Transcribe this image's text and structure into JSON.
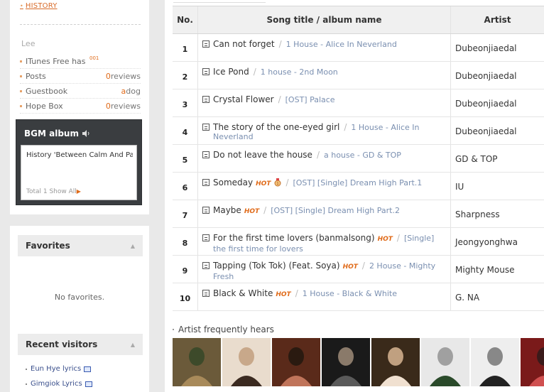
{
  "sidebar": {
    "history_link": "HISTORY",
    "owner_name": "Lee",
    "menu": [
      {
        "label": "ITunes Free has",
        "count": "",
        "count_extra": ""
      },
      {
        "label": "Posts",
        "count": "0",
        "count_extra": "reviews"
      },
      {
        "label": "Guestbook",
        "count": "a",
        "count_extra": "dog"
      },
      {
        "label": "Hope Box",
        "count": "0",
        "count_extra": "reviews"
      }
    ],
    "itunes_dots": "001",
    "bgm": {
      "title": "BGM album",
      "track": "History 'Between Calm And Pa",
      "total": "Total 1 Show All"
    },
    "favorites": {
      "title": "Favorites",
      "empty": "No favorites."
    },
    "recent_visitors": {
      "title": "Recent visitors",
      "items": [
        "Eun Hye lyrics",
        "Gimgiok Lyrics"
      ]
    }
  },
  "table": {
    "headers": {
      "no": "No.",
      "title": "Song title / album name",
      "artist": "Artist"
    },
    "rows": [
      {
        "no": "1",
        "title": "Can not forget",
        "hot": "",
        "album": "1 House - Alice In Neverland",
        "artist": "Dubeonjiaedal"
      },
      {
        "no": "2",
        "title": "Ice Pond",
        "hot": "",
        "album": "1 house - 2nd Moon",
        "artist": "Dubeonjiaedal"
      },
      {
        "no": "3",
        "title": "Crystal Flower",
        "hot": "",
        "album": "[OST] Palace",
        "artist": "Dubeonjiaedal"
      },
      {
        "no": "4",
        "title": "The story of the one-eyed girl",
        "hot": "",
        "album": "1 House - Alice In Neverland",
        "artist": "Dubeonjiaedal"
      },
      {
        "no": "5",
        "title": "Do not leave the house",
        "hot": "",
        "album": "a house - GD & TOP",
        "artist": "GD & TOP"
      },
      {
        "no": "6",
        "title": "Someday",
        "hot": "HOT",
        "album": "[OST] [Single] Dream High Part.1",
        "artist": "IU"
      },
      {
        "no": "7",
        "title": "Maybe",
        "hot": "HOT",
        "album": "[OST] [Single] Dream High Part.2",
        "artist": "Sharpness"
      },
      {
        "no": "8",
        "title": "For the first time lovers (banmalsong)",
        "hot": "HOT",
        "album": "[Single] the first time for lovers",
        "artist": "Jeongyonghwa"
      },
      {
        "no": "9",
        "title": "Tapping (Tok Tok) (Feat. Soya)",
        "hot": "HOT",
        "album": "2 House - Mighty Fresh",
        "artist": "Mighty Mouse"
      },
      {
        "no": "10",
        "title": "Black & White",
        "hot": "HOT",
        "album": "1 House - Black & White",
        "artist": "G. NA"
      }
    ]
  },
  "frequent_artists": {
    "label": "Artist frequently hears",
    "photos": [
      "group-photo",
      "female-portrait",
      "male-portrait",
      "band-photo",
      "female-portrait-hat",
      "duo-photo",
      "female-portrait-bw",
      "portrait-red"
    ]
  },
  "colors": {
    "accent_orange": "#e06b1a",
    "album_blue": "#7a8fb0",
    "bgm_dark": "#3a3d40"
  }
}
